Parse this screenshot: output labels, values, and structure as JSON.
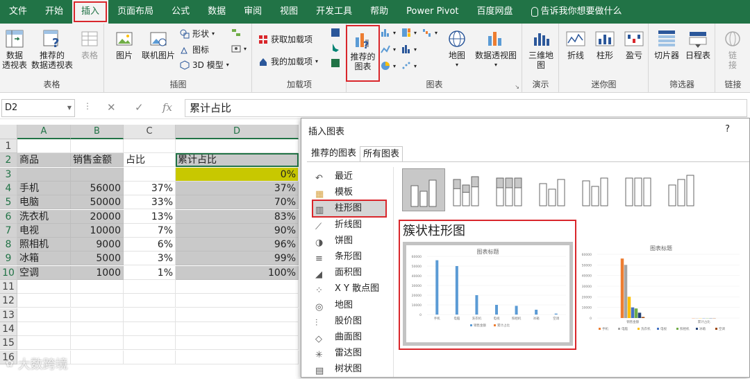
{
  "menu": {
    "items": [
      "文件",
      "开始",
      "插入",
      "页面布局",
      "公式",
      "数据",
      "审阅",
      "视图",
      "开发工具",
      "帮助",
      "Power Pivot",
      "百度网盘"
    ],
    "tell_me": "告诉我你想要做什么"
  },
  "ribbon": {
    "tables": {
      "pivot": "数据\n透视表",
      "recommended_pivot": "推荐的\n数据透视表",
      "table": "表格",
      "label": "表格"
    },
    "illustrations": {
      "picture": "图片",
      "online_picture": "联机图片",
      "shapes": "形状",
      "icons": "图标",
      "model3d": "3D 模型",
      "label": "插图"
    },
    "addins": {
      "get": "获取加载项",
      "my": "我的加载项",
      "label": "加载项"
    },
    "charts": {
      "recommended": "推荐的\n图表",
      "map": "地图",
      "pivot_chart": "数据透视图",
      "label": "图表"
    },
    "tours": {
      "map3d": "三维地\n图",
      "label": "演示"
    },
    "sparklines": {
      "line": "折线",
      "column": "柱形",
      "winloss": "盈亏",
      "label": "迷你图"
    },
    "filters": {
      "slicer": "切片器",
      "timeline": "日程表",
      "label": "筛选器"
    },
    "links": {
      "link": "链\n接",
      "label": "链接"
    }
  },
  "formula_bar": {
    "name_box": "D2",
    "formula": "累计占比"
  },
  "sheet": {
    "columns": [
      "A",
      "B",
      "C",
      "D"
    ],
    "rows": [
      {
        "n": "1",
        "a": "",
        "b": "",
        "c": "",
        "d": ""
      },
      {
        "n": "2",
        "a": "商品",
        "b": "销售金额",
        "c": "占比",
        "d": "累计占比"
      },
      {
        "n": "3",
        "a": "",
        "b": "",
        "c": "",
        "d": "0%"
      },
      {
        "n": "4",
        "a": "手机",
        "b": "56000",
        "c": "37%",
        "d": "37%"
      },
      {
        "n": "5",
        "a": "电脑",
        "b": "50000",
        "c": "33%",
        "d": "70%"
      },
      {
        "n": "6",
        "a": "洗衣机",
        "b": "20000",
        "c": "13%",
        "d": "83%"
      },
      {
        "n": "7",
        "a": "电视",
        "b": "10000",
        "c": "7%",
        "d": "90%"
      },
      {
        "n": "8",
        "a": "照相机",
        "b": "9000",
        "c": "6%",
        "d": "96%"
      },
      {
        "n": "9",
        "a": "冰箱",
        "b": "5000",
        "c": "3%",
        "d": "99%"
      },
      {
        "n": "10",
        "a": "空调",
        "b": "1000",
        "c": "1%",
        "d": "100%"
      },
      {
        "n": "11",
        "a": "",
        "b": "",
        "c": "",
        "d": ""
      },
      {
        "n": "12",
        "a": "",
        "b": "",
        "c": "",
        "d": ""
      },
      {
        "n": "13",
        "a": "",
        "b": "",
        "c": "",
        "d": ""
      },
      {
        "n": "14",
        "a": "",
        "b": "",
        "c": "",
        "d": ""
      },
      {
        "n": "15",
        "a": "",
        "b": "",
        "c": "",
        "d": ""
      },
      {
        "n": "16",
        "a": "",
        "b": "",
        "c": "",
        "d": ""
      }
    ]
  },
  "dialog": {
    "title": "插入图表",
    "help": "?",
    "tabs": [
      "推荐的图表",
      "所有图表"
    ],
    "categories": [
      "最近",
      "模板",
      "柱形图",
      "折线图",
      "饼图",
      "条形图",
      "面积图",
      "X Y 散点图",
      "地图",
      "股价图",
      "曲面图",
      "雷达图",
      "树状图"
    ],
    "selected_category": "柱形图",
    "preview_title": "簇状柱形图",
    "chart_title": "图表标题"
  },
  "watermark": "大数跨境",
  "colors": {
    "excel_green": "#217346",
    "highlight_red": "#d9262b",
    "yellow": "#c8c800",
    "bar_blue": "#5b9bd5",
    "bar_orange": "#ed7d31"
  },
  "chart_data": [
    {
      "type": "bar",
      "title": "图表标题",
      "categories": [
        "手机",
        "电脑",
        "洗衣机",
        "电视",
        "照相机",
        "冰箱",
        "空调"
      ],
      "series": [
        {
          "name": "销售金额",
          "values": [
            56000,
            50000,
            20000,
            10000,
            9000,
            5000,
            1000
          ]
        },
        {
          "name": "累计占比",
          "values": [
            0.37,
            0.7,
            0.83,
            0.9,
            0.96,
            0.99,
            1.0
          ]
        }
      ],
      "ylim": [
        0,
        60000
      ],
      "yticks": [
        "60000",
        "50000",
        "40000",
        "30000",
        "20000",
        "10000",
        "0"
      ],
      "legend": "bottom"
    },
    {
      "type": "bar",
      "title": "图表标题",
      "categories": [
        "销售金额",
        "累计占比"
      ],
      "series": [
        {
          "name": "手机",
          "values": [
            56000,
            0.37
          ]
        },
        {
          "name": "电脑",
          "values": [
            50000,
            0.7
          ]
        },
        {
          "name": "洗衣机",
          "values": [
            20000,
            0.83
          ]
        },
        {
          "name": "电视",
          "values": [
            10000,
            0.9
          ]
        },
        {
          "name": "照相机",
          "values": [
            9000,
            0.96
          ]
        },
        {
          "name": "冰箱",
          "values": [
            5000,
            0.99
          ]
        },
        {
          "name": "空调",
          "values": [
            1000,
            1.0
          ]
        }
      ],
      "ylim": [
        0,
        60000
      ],
      "yticks": [
        "60000",
        "50000",
        "40000",
        "30000",
        "20000",
        "10000",
        "0"
      ],
      "legend": "bottom"
    }
  ]
}
